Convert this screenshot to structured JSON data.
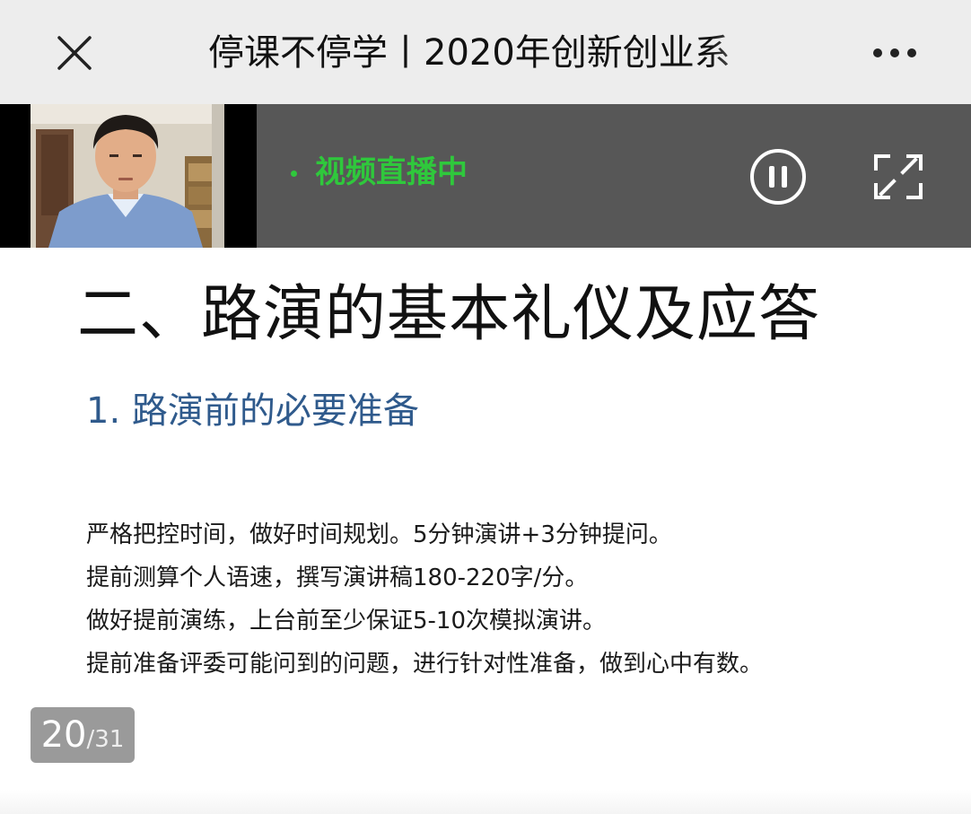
{
  "nav": {
    "title": "停课不停学丨2020年创新创业系",
    "close_icon": "close-icon",
    "more_icon": "more-dots-icon",
    "background": "#ededed"
  },
  "live": {
    "status": "视频直播中",
    "status_color": "#2fc83c",
    "pause_icon": "pause-circle-icon",
    "fullscreen_icon": "fullscreen-expand-icon",
    "background": "#575757"
  },
  "slide": {
    "title": "二、路演的基本礼仪及应答",
    "subtitle": "1.  路演前的必要准备",
    "subtitle_color": "#2f5a8c",
    "bullets": [
      "严格把控时间，做好时间规划。5分钟演讲+3分钟提问。",
      "提前测算个人语速，撰写演讲稿180-220字/分。",
      "做好提前演练，上台前至少保证5-10次模拟演讲。",
      "提前准备评委可能问到的问题，进行针对性准备，做到心中有数。"
    ]
  },
  "pager": {
    "current": "20",
    "separator": "/",
    "total": "31"
  }
}
